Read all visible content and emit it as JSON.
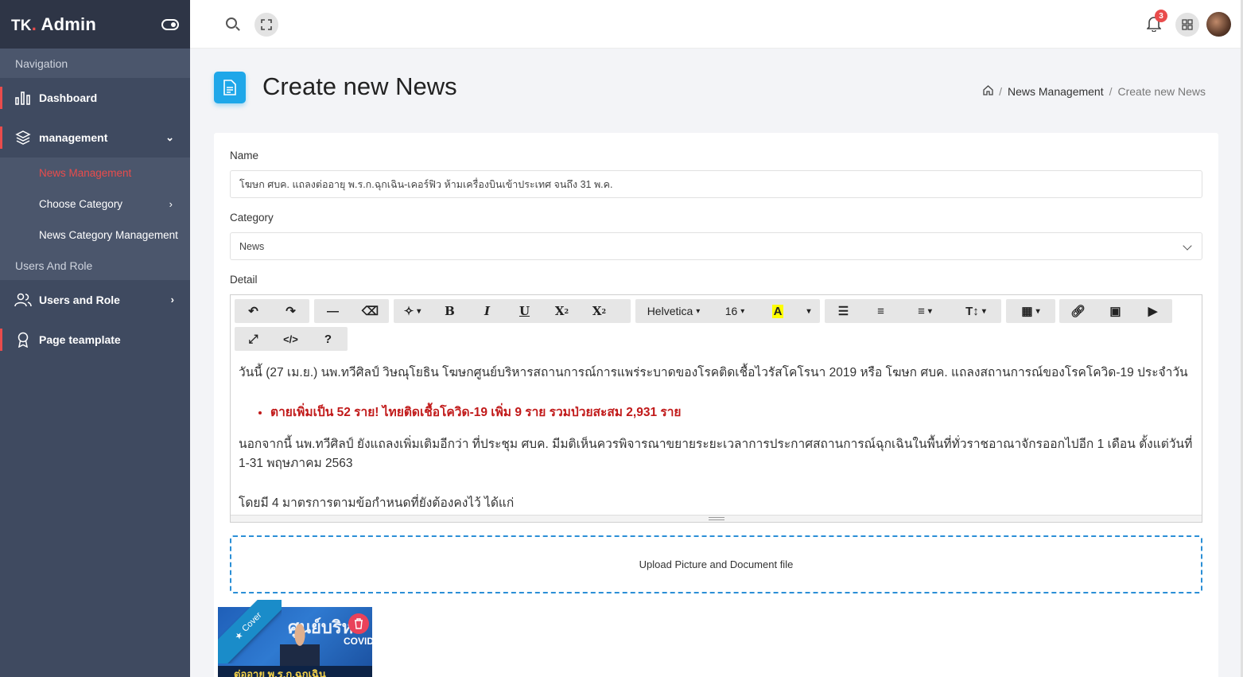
{
  "brand": {
    "name": "TK",
    "dot": ".",
    "suffix": " Admin"
  },
  "sidebar": {
    "section_navigation": "Navigation",
    "items": [
      {
        "label": "Dashboard",
        "icon": "bar-chart-icon"
      },
      {
        "label": "management",
        "icon": "layers-icon"
      }
    ],
    "submenu": [
      {
        "label": "News Management"
      },
      {
        "label": "Choose Category"
      },
      {
        "label": "News Category Management"
      }
    ],
    "section_users": "Users And Role",
    "users_item": {
      "label": "Users and Role",
      "icon": "users-icon"
    },
    "template_item": {
      "label": "Page teamplate",
      "icon": "award-icon"
    }
  },
  "topbar": {
    "notification_count": "3"
  },
  "page": {
    "title": "Create new News",
    "breadcrumb": {
      "parent": "News Management",
      "sep": "/",
      "current": "Create new News"
    }
  },
  "form": {
    "name_label": "Name",
    "name_value": "โฆษก ศบค. แถลงต่ออายุ พ.ร.ก.ฉุกเฉิน-เคอร์ฟิว ห้ามเครื่องบินเข้าประเทศ จนถึง 31 พ.ค.",
    "category_label": "Category",
    "category_value": "News",
    "detail_label": "Detail",
    "toolbar": {
      "font_name": "Helvetica",
      "font_size": "16"
    },
    "content": {
      "p1": "วันนี้ (27 เม.ย.) นพ.ทวีศิลป์ วิษณุโยธิน โฆษกศูนย์บริหารสถานการณ์การแพร่ระบาดของโรคติดเชื้อไวรัสโคโรนา 2019 หรือ โฆษก ศบค. แถลงสถานการณ์ของโรคโควิด-19 ประจำวัน",
      "bullet": "ตายเพิ่มเป็น 52 ราย! ไทยติดเชื้อโควิด-19 เพิ่ม 9 ราย รวมป่วยสะสม 2,931 ราย",
      "p2": "นอกจากนี้ นพ.ทวีศิลป์ ยังแถลงเพิ่มเติมอีกว่า ที่ประชุม ศบค. มีมติเห็นควรพิจารณาขยายระยะเวลาการประกาศสถานการณ์ฉุกเฉินในพื้นที่ทั่วราชอาณาจักรออกไปอีก 1 เดือน ตั้งแต่วันที่ 1-31 พฤษภาคม 2563",
      "p3": "โดยมี 4 มาตรการตามข้อกำหนดที่ยังต้องคงไว้ ได้แก่"
    },
    "upload_label": "Upload Picture and Document file",
    "thumb": {
      "cover_label": "Cover",
      "caption": "ต่ออายุ พ.ร.ก.ฉุกเฉิน",
      "headline": "ศูนย์บริหา",
      "covid": "COVID"
    }
  },
  "colors": {
    "accent": "#e94c4c",
    "primary": "#1ea7e9",
    "sidebar": "#3f4a60"
  }
}
